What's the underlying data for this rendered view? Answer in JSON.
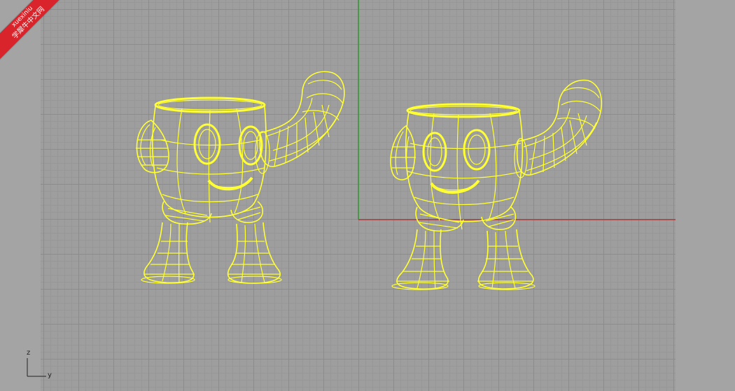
{
  "watermark": {
    "site": "xuexiniu",
    "title": "学犀牛中文网"
  },
  "axis_icon": {
    "vertical_label": "z",
    "horizontal_label": "y"
  },
  "colors": {
    "wireframe": "#ffff33",
    "axis_green": "#2e9a2e",
    "axis_red": "#a83a3a",
    "badge": "#d8242a"
  },
  "objects": [
    {
      "name": "character-cup-left"
    },
    {
      "name": "character-cup-right"
    }
  ]
}
